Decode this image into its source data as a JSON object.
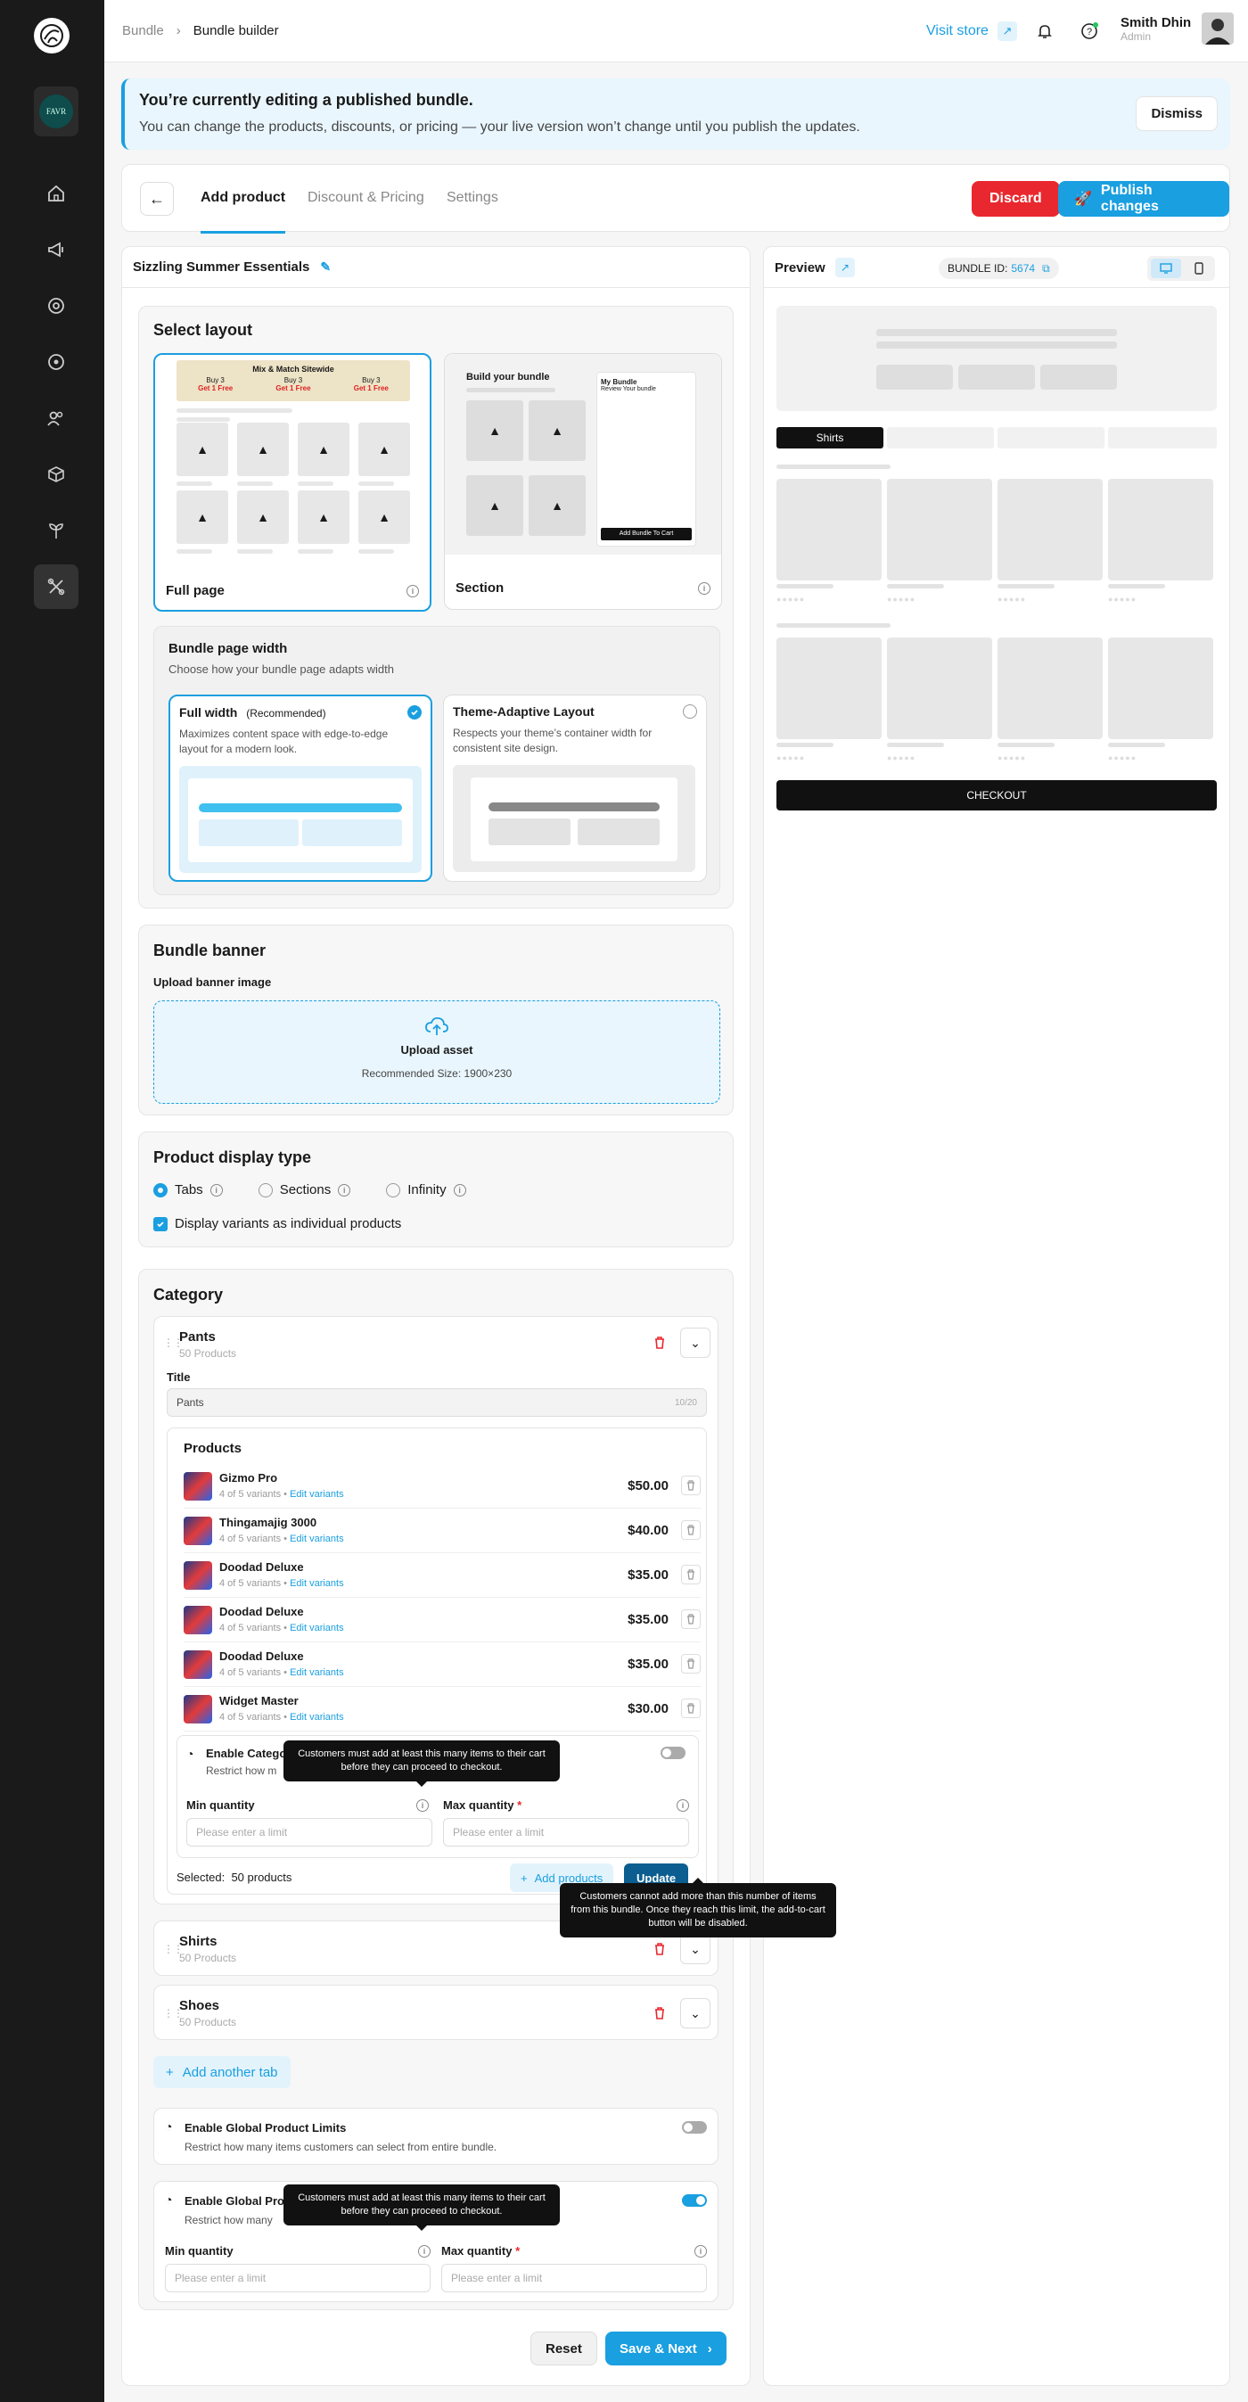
{
  "sidebar": {
    "logo": "logo-icon",
    "store_badge": "FAVR",
    "items": [
      "home-icon",
      "megaphone-icon",
      "target-icon",
      "circle-dot-icon",
      "users-icon",
      "box-icon",
      "plant-icon",
      "tools-icon"
    ]
  },
  "topbar": {
    "breadcrumb_root": "Bundle",
    "breadcrumb_current": "Bundle builder",
    "visit_store": "Visit store",
    "user_name": "Smith Dhin",
    "user_role": "Admin"
  },
  "banner": {
    "title": "You’re currently editing a published bundle.",
    "subtitle": "You can change the products, discounts, or pricing — your live version won’t change until you publish the updates.",
    "dismiss": "Dismiss"
  },
  "tabs": {
    "items": [
      "Add product",
      "Discount & Pricing",
      "Settings"
    ],
    "discard": "Discard",
    "publish": "Publish changes"
  },
  "editor": {
    "bundle_name": "Sizzling Summer Essentials",
    "layout": {
      "title": "Select layout",
      "full_page": {
        "label": "Full page",
        "thumb_title": "Mix & Match Sitewide",
        "deals": [
          {
            "buy": "Buy 3",
            "get": "Get 1 Free"
          },
          {
            "buy": "Buy 3",
            "get": "Get 1 Free"
          },
          {
            "buy": "Buy 3",
            "get": "Get 1 Free"
          }
        ]
      },
      "section": {
        "label": "Section",
        "thumb_title": "Build your bundle",
        "side_title": "My Bundle",
        "side_sub": "Review Your bundle",
        "side_button": "Add Bundle To Cart"
      }
    },
    "width": {
      "title": "Bundle page width",
      "subtitle": "Choose how your bundle page adapts width",
      "full": {
        "label": "Full width",
        "tag": "(Recommended)",
        "desc": "Maximizes content space with edge-to-edge layout for a modern look."
      },
      "theme": {
        "label": "Theme-Adaptive Layout",
        "desc": "Respects your theme’s container width for consistent site design."
      }
    },
    "banner": {
      "title": "Bundle banner",
      "label": "Upload banner image",
      "upload": "Upload asset",
      "size": "Recommended Size: 1900×230"
    },
    "display": {
      "title": "Product display type",
      "options": [
        "Tabs",
        "Sections",
        "Infinity"
      ],
      "selected": "Tabs",
      "variants_label": "Display variants as individual products"
    },
    "category": {
      "title": "Category",
      "pants": {
        "name": "Pants",
        "count": "50 Products",
        "title_label": "Title",
        "title_value": "Pants",
        "title_counter": "10/20",
        "products_title": "Products",
        "products": [
          {
            "name": "Gizmo Pro",
            "variants": "4 of 5 variants",
            "edit": "Edit variants",
            "price": "$50.00"
          },
          {
            "name": "Thingamajig 3000",
            "variants": "4 of 5 variants",
            "edit": "Edit variants",
            "price": "$40.00"
          },
          {
            "name": "Doodad Deluxe",
            "variants": "4 of 5 variants",
            "edit": "Edit variants",
            "price": "$35.00"
          },
          {
            "name": "Doodad Deluxe",
            "variants": "4 of 5 variants",
            "edit": "Edit variants",
            "price": "$35.00"
          },
          {
            "name": "Doodad Deluxe",
            "variants": "4 of 5 variants",
            "edit": "Edit variants",
            "price": "$35.00"
          },
          {
            "name": "Widget Master",
            "variants": "4 of 5 variants",
            "edit": "Edit variants",
            "price": "$30.00"
          }
        ],
        "limit_title": "Enable Catego",
        "limit_sub": "Restrict how m",
        "min_label": "Min quantity",
        "max_label": "Max quantity",
        "min_placeholder": "Please enter a limit",
        "max_placeholder": "Please enter a limit",
        "selected_label": "Selected:",
        "selected_value": "50 products",
        "add_products": "Add products",
        "update": "Update"
      },
      "shirts": {
        "name": "Shirts",
        "count": "50 Products"
      },
      "shoes": {
        "name": "Shoes",
        "count": "50 Products"
      },
      "add_tab": "Add another tab"
    },
    "global_limits": {
      "title": "Enable Global Product Limits",
      "subtitle": "Restrict how many items customers can select from entire bundle."
    },
    "global_limits_2": {
      "title": "Enable Global Pro",
      "subtitle": "Restrict how many",
      "min_label": "Min quantity",
      "max_label": "Max quantity",
      "min_placeholder": "Please enter a limit",
      "max_placeholder": "Please enter a limit"
    },
    "tooltips": {
      "min": "Customers must add at least this many items to their cart before they can proceed to checkout.",
      "max": "Customers cannot add more than this number of items from this bundle. Once they reach this limit, the add-to-cart button will be disabled."
    },
    "reset": "Reset",
    "save": "Save & Next"
  },
  "preview": {
    "title": "Preview",
    "bundle_id_label": "BUNDLE ID:",
    "bundle_id_value": "5674",
    "active_tab": "Shirts",
    "checkout": "CHECKOUT"
  },
  "colors": {
    "accent": "#1a9fe0",
    "danger": "#e8282e",
    "sidebar": "#1a1a1a"
  }
}
